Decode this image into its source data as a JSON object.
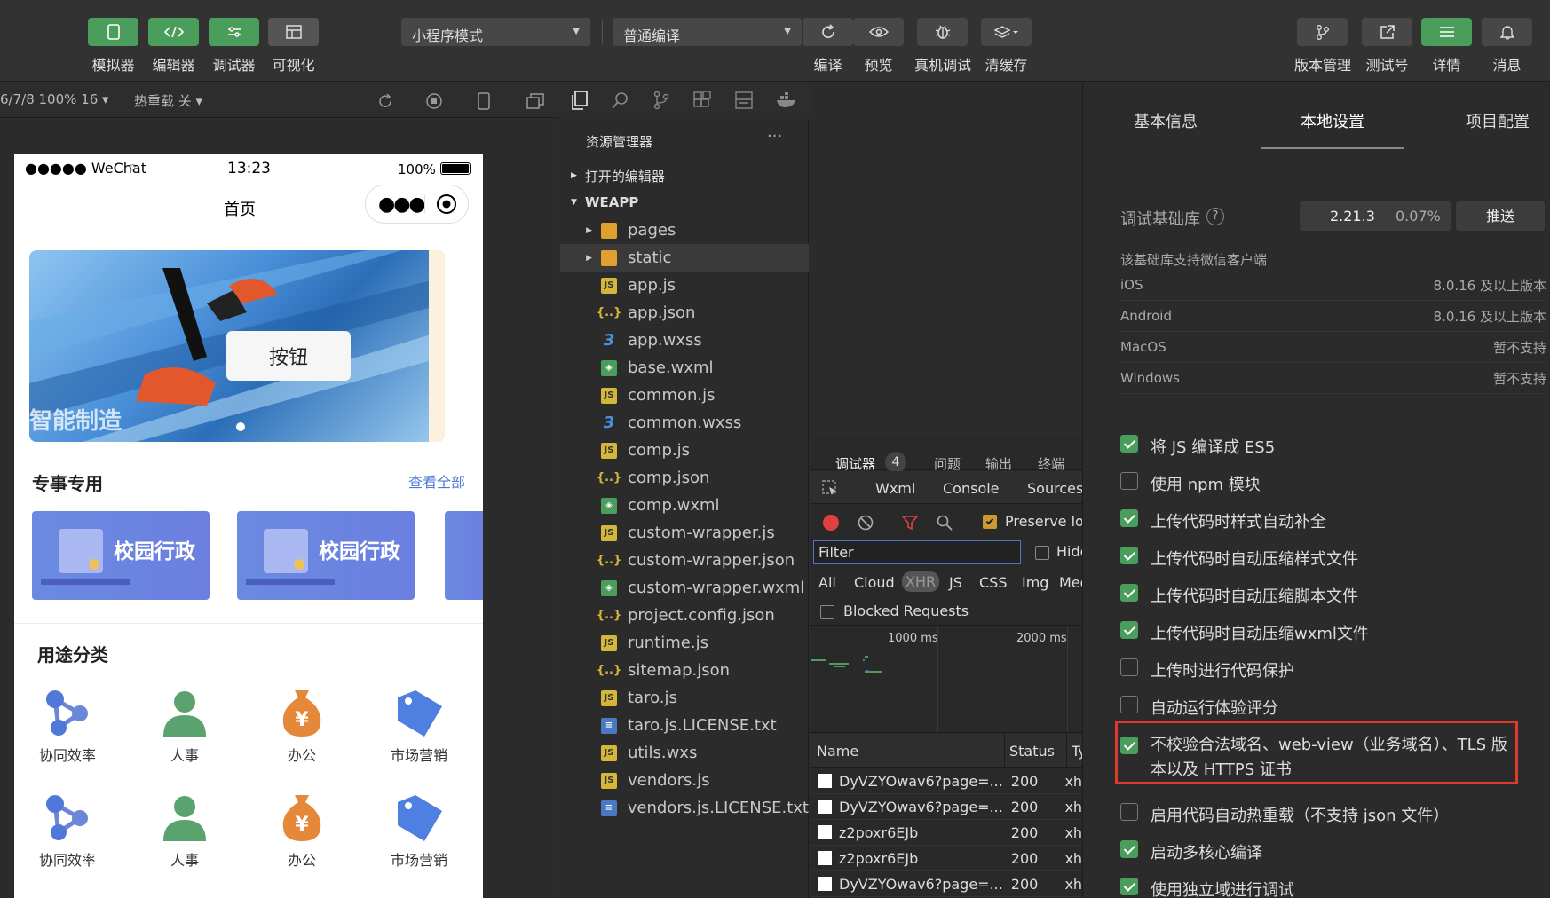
{
  "toolbar": {
    "left_buttons": [
      {
        "label": "模拟器",
        "icon": "phone-icon",
        "active": true
      },
      {
        "label": "编辑器",
        "icon": "code-icon",
        "active": true
      },
      {
        "label": "调试器",
        "icon": "debug-icon",
        "active": true
      },
      {
        "label": "可视化",
        "icon": "layout-icon",
        "active": false
      }
    ],
    "mode_select": "小程序模式",
    "compile_select": "普通编译",
    "center_buttons": [
      {
        "label": "编译",
        "icon": "refresh-icon"
      },
      {
        "label": "预览",
        "icon": "eye-icon"
      },
      {
        "label": "真机调试",
        "icon": "bug-icon"
      },
      {
        "label": "清缓存",
        "icon": "layers-icon"
      }
    ],
    "right_buttons": [
      {
        "label": "版本管理",
        "icon": "branch-icon"
      },
      {
        "label": "测试号",
        "icon": "external-icon"
      },
      {
        "label": "详情",
        "icon": "menu-icon",
        "active": true
      },
      {
        "label": "消息",
        "icon": "bell-icon"
      }
    ]
  },
  "simbar": {
    "device": "6/7/8 100% 16 ▾",
    "hotreload": "热重载 关 ▾"
  },
  "phone": {
    "carrier": "●●●●● WeChat",
    "time": "13:23",
    "battery": "100%",
    "nav_title": "首页",
    "banner_button": "按钮",
    "banner_text": "智能制造",
    "section1_title": "专事专用",
    "section1_link": "查看全部",
    "cards": [
      "校园行政",
      "校园行政"
    ],
    "section2_title": "用途分类",
    "categories": [
      {
        "label": "协同效率",
        "icon": "network-icon"
      },
      {
        "label": "人事",
        "icon": "person-icon"
      },
      {
        "label": "办公",
        "icon": "money-bag-icon"
      },
      {
        "label": "市场营销",
        "icon": "tag-icon"
      },
      {
        "label": "协同效率",
        "icon": "network-icon"
      },
      {
        "label": "人事",
        "icon": "person-icon"
      },
      {
        "label": "办公",
        "icon": "money-bag-icon"
      },
      {
        "label": "市场营销",
        "icon": "tag-icon"
      }
    ]
  },
  "explorer": {
    "title": "资源管理器",
    "more": "···",
    "open_editors": "打开的编辑器",
    "project": "WEAPP",
    "files": [
      {
        "name": "pages",
        "type": "folder"
      },
      {
        "name": "static",
        "type": "folder"
      },
      {
        "name": "app.js",
        "type": "js"
      },
      {
        "name": "app.json",
        "type": "json"
      },
      {
        "name": "app.wxss",
        "type": "css"
      },
      {
        "name": "base.wxml",
        "type": "wxml"
      },
      {
        "name": "common.js",
        "type": "js"
      },
      {
        "name": "common.wxss",
        "type": "css"
      },
      {
        "name": "comp.js",
        "type": "js"
      },
      {
        "name": "comp.json",
        "type": "json"
      },
      {
        "name": "comp.wxml",
        "type": "wxml"
      },
      {
        "name": "custom-wrapper.js",
        "type": "js"
      },
      {
        "name": "custom-wrapper.json",
        "type": "json"
      },
      {
        "name": "custom-wrapper.wxml",
        "type": "wxml"
      },
      {
        "name": "project.config.json",
        "type": "json"
      },
      {
        "name": "runtime.js",
        "type": "js"
      },
      {
        "name": "sitemap.json",
        "type": "json"
      },
      {
        "name": "taro.js",
        "type": "js"
      },
      {
        "name": "taro.js.LICENSE.txt",
        "type": "txt"
      },
      {
        "name": "utils.wxs",
        "type": "js"
      },
      {
        "name": "vendors.js",
        "type": "js"
      },
      {
        "name": "vendors.js.LICENSE.txt",
        "type": "txt"
      }
    ]
  },
  "devtools": {
    "tabs": [
      "调试器",
      "问题",
      "输出",
      "终端"
    ],
    "badge": "4",
    "subtabs": [
      "Wxml",
      "Console",
      "Sources"
    ],
    "preserve": "Preserve log",
    "filter_placeholder": "Filter",
    "hide": "Hide data URLs",
    "types": [
      "All",
      "Cloud",
      "XHR",
      "JS",
      "CSS",
      "Img",
      "Media"
    ],
    "blocked": "Blocked Requests",
    "timeline": [
      "1000 ms",
      "2000 ms"
    ],
    "columns": [
      "Name",
      "Status",
      "Type"
    ],
    "rows": [
      {
        "name": "DyVZYOwav6?page=...",
        "status": "200",
        "type": "xhr"
      },
      {
        "name": "DyVZYOwav6?page=...",
        "status": "200",
        "type": "xhr"
      },
      {
        "name": "z2poxr6EJb",
        "status": "200",
        "type": "xhr"
      },
      {
        "name": "z2poxr6EJb",
        "status": "200",
        "type": "xhr"
      },
      {
        "name": "DyVZYOwav6?page=...",
        "status": "200",
        "type": "xhr"
      }
    ]
  },
  "details": {
    "tabs": [
      "基本信息",
      "本地设置",
      "项目配置"
    ],
    "lib_label": "调试基础库",
    "lib_version": "2.21.3",
    "lib_percent": "0.07%",
    "push": "推送",
    "support_title": "该基础库支持微信客户端",
    "systems": [
      {
        "name": "iOS",
        "value": "8.0.16 及以上版本"
      },
      {
        "name": "Android",
        "value": "8.0.16 及以上版本"
      },
      {
        "name": "MacOS",
        "value": "暂不支持"
      },
      {
        "name": "Windows",
        "value": "暂不支持"
      }
    ],
    "options": [
      {
        "label": "将 JS 编译成 ES5",
        "checked": true
      },
      {
        "label": "使用 npm 模块",
        "checked": false
      },
      {
        "label": "上传代码时样式自动补全",
        "checked": true
      },
      {
        "label": "上传代码时自动压缩样式文件",
        "checked": true
      },
      {
        "label": "上传代码时自动压缩脚本文件",
        "checked": true
      },
      {
        "label": "上传代码时自动压缩wxml文件",
        "checked": true
      },
      {
        "label": "上传时进行代码保护",
        "checked": false
      },
      {
        "label": "自动运行体验评分",
        "checked": false
      },
      {
        "label": "不校验合法域名、web-view（业务域名）、TLS 版本以及 HTTPS 证书",
        "checked": true,
        "highlighted": true
      },
      {
        "label": "启用代码自动热重载（不支持 json 文件）",
        "checked": false
      },
      {
        "label": "启动多核心编译",
        "checked": true
      },
      {
        "label": "使用独立域进行调试",
        "checked": true
      }
    ],
    "highlight_color": "#e0392e"
  }
}
